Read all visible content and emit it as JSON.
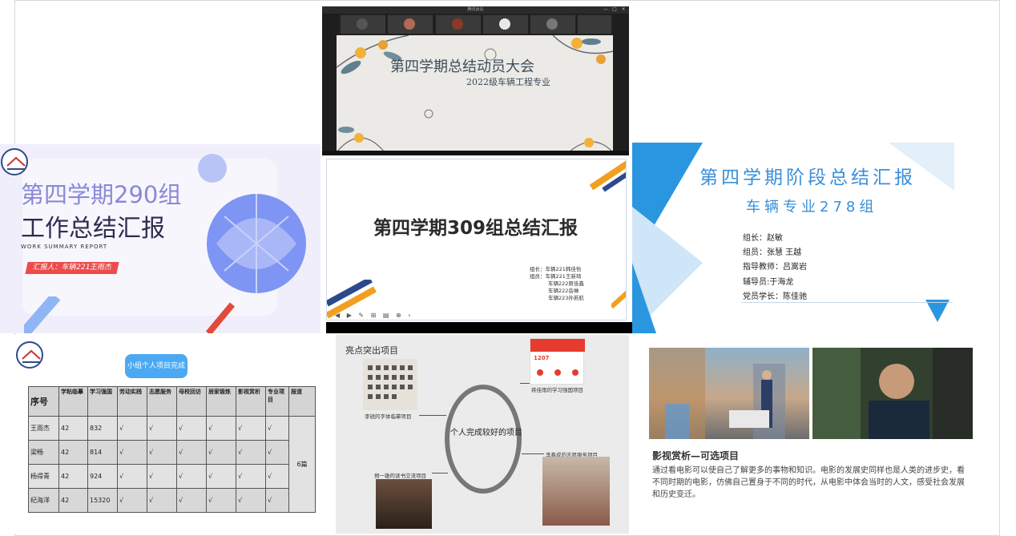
{
  "slide_a": {
    "window_title": "腾讯会议",
    "window_buttons": [
      "—",
      "□",
      "✕"
    ],
    "participants": [
      "",
      "",
      "",
      "",
      "",
      ""
    ],
    "title": "第四学期总结动员大会",
    "subtitle": "2022级车辆工程专业",
    "bottom_text": ""
  },
  "slide_b": {
    "title_line1": "第四学期290组",
    "title_line2": "工作总结汇报",
    "english": "WORK SUMMARY REPORT",
    "reporter": "汇报人：车辆221王雨杰"
  },
  "slide_c": {
    "title": "第四学期309组总结汇报",
    "members": [
      "组长：车辆221韩佳怡",
      "组员：车辆221王新琦",
      "车辆222原佳鑫",
      "车辆222岳琳",
      "车辆223孙若航"
    ],
    "toolbar": "◀ ▶ ✎ ⊞ ▤ ⊕ ‹"
  },
  "slide_d": {
    "title": "第四学期阶段总结汇报",
    "subtitle": "车辆专业278组",
    "lines": [
      "组长：赵敏",
      "组员：张慧  王越",
      "指导教师：吕嵩岩",
      "辅导员:于海龙",
      "党员学长：陈佳驰"
    ],
    "colors": {
      "accent": "#2b96e0",
      "light": "#cfe6f8"
    }
  },
  "slide_e": {
    "pill": "小组个人项目完成情况",
    "headers": [
      "序号",
      "学粘临摹",
      "学习强国",
      "劳动实践",
      "志愿服务",
      "母校回访",
      "居家锻炼",
      "影视赏析",
      "专业项目",
      "报道"
    ],
    "rows": [
      [
        "王雨杰",
        "42",
        "832",
        "√",
        "√",
        "√",
        "√",
        "√",
        "√"
      ],
      [
        "梁畅",
        "42",
        "814",
        "√",
        "√",
        "√",
        "√",
        "√",
        "√"
      ],
      [
        "杨得青",
        "42",
        "924",
        "√",
        "√",
        "√",
        "√",
        "√",
        "√"
      ],
      [
        "纪海洋",
        "42",
        "15320",
        "√",
        "√",
        "√",
        "√",
        "√",
        "√"
      ]
    ],
    "report_value": "6篇"
  },
  "slide_f": {
    "heading": "亮点突出项目",
    "center": "个人完成较好的项目",
    "captions": {
      "top_right": "蒋佳雨的学习强国项目",
      "left": "李锐的字体临摹项目",
      "right": "李鑫成的志愿服务项目",
      "bottom_left": "郑一雄的读书交流项目"
    },
    "phone_score": "1207"
  },
  "slide_g": {
    "heading": "影视赏析—可选项目",
    "body": "通过看电影可以使自己了解更多的事物和知识。电影的发展史同样也是人类的进步史，看不同时期的电影，仿佛自己置身于不同的时代，从电影中体会当时的人文，感受社会发展和历史变迁。"
  }
}
